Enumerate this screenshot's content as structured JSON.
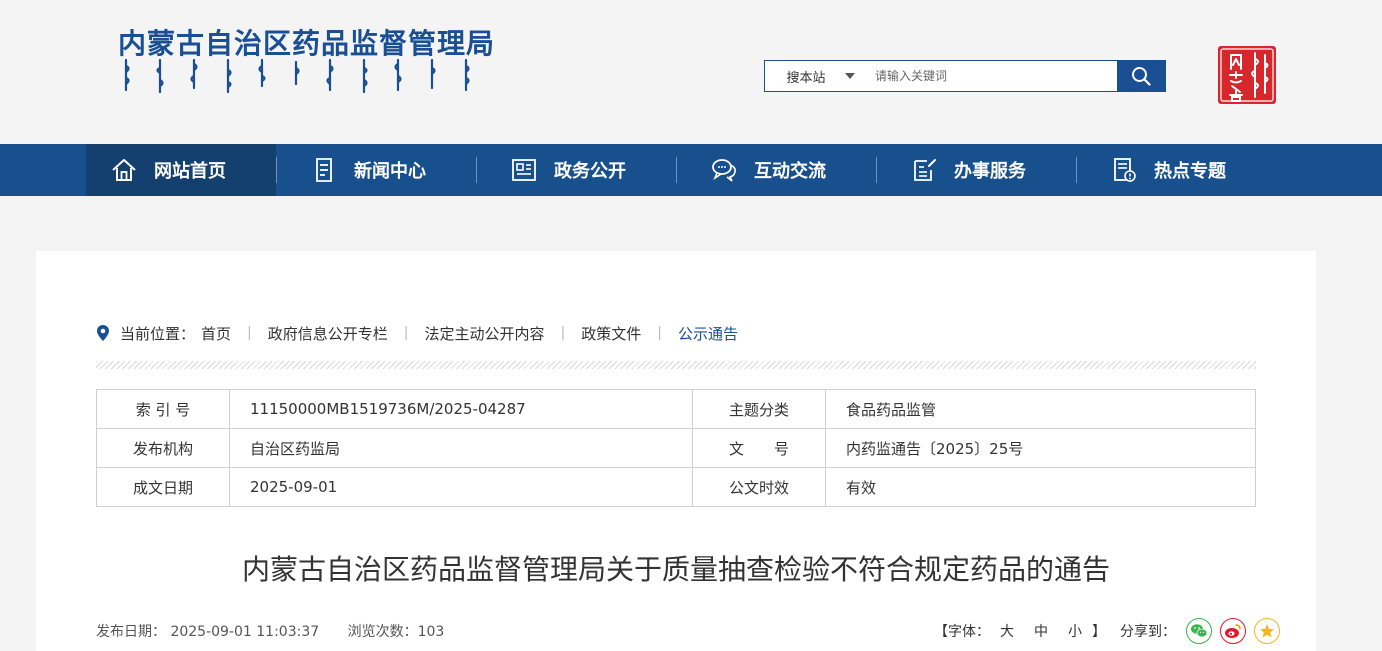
{
  "header": {
    "site_title": "内蒙古自治区药品监督管理局",
    "seal_text": "内蒙古"
  },
  "search": {
    "scope_label": "搜本站",
    "placeholder": "请输入关键词"
  },
  "nav": {
    "items": [
      {
        "label": "网站首页",
        "icon": "home-icon"
      },
      {
        "label": "新闻中心",
        "icon": "news-icon"
      },
      {
        "label": "政务公开",
        "icon": "gov-info-icon"
      },
      {
        "label": "互动交流",
        "icon": "chat-icon"
      },
      {
        "label": "办事服务",
        "icon": "service-icon"
      },
      {
        "label": "热点专题",
        "icon": "topic-icon"
      }
    ]
  },
  "breadcrumb": {
    "prefix": "当前位置：",
    "items": [
      "首页",
      "政府信息公开专栏",
      "法定主动公开内容",
      "政策文件",
      "公示通告"
    ]
  },
  "info": {
    "rows": [
      {
        "k1": "索 引 号",
        "v1": "11150000MB1519736M/2025-04287",
        "k2": "主题分类",
        "v2": "食品药品监管"
      },
      {
        "k1": "发布机构",
        "v1": "自治区药监局",
        "k2": "文　　号",
        "v2": "内药监通告〔2025〕25号"
      },
      {
        "k1": "成文日期",
        "v1": "2025-09-01",
        "k2": "公文时效",
        "v2": "有效"
      }
    ]
  },
  "article": {
    "title": "内蒙古自治区药品监督管理局关于质量抽查检验不符合规定药品的通告",
    "publish_date": "发布日期： 2025-09-01 11:03:37",
    "views": "浏览次数：103"
  },
  "tools": {
    "font_prefix": "【字体：",
    "font_large": "大",
    "font_medium": "中",
    "font_small": "小",
    "font_suffix": "】",
    "share_label": "分享到："
  },
  "colors": {
    "primary": "#1a4f93",
    "nav_bg": "#18508d",
    "nav_active": "#13406f",
    "seal_red": "#d7262c"
  }
}
